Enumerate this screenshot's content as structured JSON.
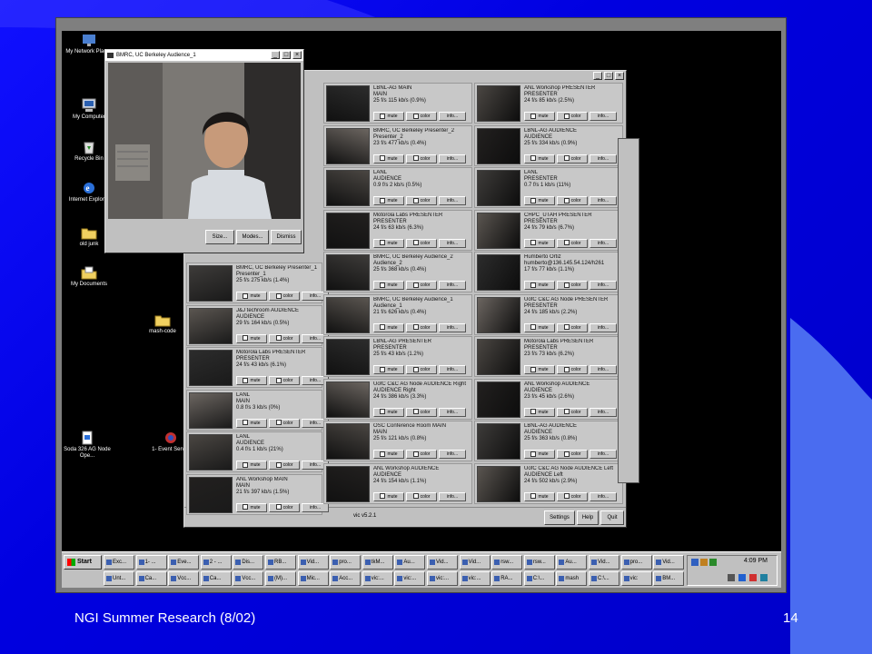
{
  "slide": {
    "footer_left": "NGI Summer Research (8/02)",
    "page_number": "14",
    "colors": {
      "background": "#0000ee",
      "frame": "#7f7f7f",
      "desktop": "#000000"
    }
  },
  "desktop_icons": [
    {
      "label": "My Network Places",
      "icon": "network-icon"
    },
    {
      "label": "My Computer",
      "icon": "computer-icon"
    },
    {
      "label": "Recycle Bin",
      "icon": "recycle-bin-icon"
    },
    {
      "label": "Internet Explorer",
      "icon": "ie-icon"
    },
    {
      "label": "old junk",
      "icon": "folder-icon"
    },
    {
      "label": "My Documents",
      "icon": "documents-icon"
    },
    {
      "label": "mash-code",
      "icon": "folder-icon"
    },
    {
      "label": "Soda 326 AG Node Ope...",
      "icon": "file-icon"
    },
    {
      "label": "1- Event Server",
      "icon": "server-icon"
    }
  ],
  "video_window": {
    "title": "BMRC, UC Berkeley Audience_1",
    "buttons": [
      "Size...",
      "Modes...",
      "Dismiss"
    ]
  },
  "vic_window": {
    "status": "vic v5.2.1",
    "buttons": [
      "Settings",
      "Help",
      "Quit"
    ],
    "labels": {
      "mute": "mute",
      "color": "color",
      "info": "info..."
    },
    "left_partial": [
      {
        "title": "BMRC, UC Berkeley Presenter_1",
        "sub": "Presenter_1",
        "stats": "25 f/s   275 kb/s   (1.4%)"
      },
      {
        "title": "J&J techroom AUDIENCE",
        "sub": "AUDIENCE",
        "stats": "29 f/s   164 kb/s   (0.5%)"
      },
      {
        "title": "Motorola Labs PRESENTER",
        "sub": "PRESENTER",
        "stats": "24 f/s   43 kb/s   (6.1%)"
      },
      {
        "title": "LANL",
        "sub": "MAIN",
        "stats": "0.8 f/s   3 kb/s   (0%)"
      },
      {
        "title": "LANL",
        "sub": "AUDIENCE",
        "stats": "0.4 f/s   1 kb/s   (21%)"
      },
      {
        "title": "ANL Workshop MAIN",
        "sub": "MAIN",
        "stats": "21 f/s   397 kb/s   (1.5%)"
      }
    ],
    "middle": [
      {
        "title": "LBNL-AG MAIN",
        "sub": "MAIN",
        "stats": "25 f/s   115 kb/s   (0.9%)"
      },
      {
        "title": "BMRC, UC Berkeley Presenter_2",
        "sub": "Presenter_2",
        "stats": "23 f/s   477 kb/s   (0.4%)"
      },
      {
        "title": "LANL",
        "sub": "AUDIENCE",
        "stats": "0.9 f/s   2 kb/s   (0.5%)"
      },
      {
        "title": "Motorola Labs PRESENTER",
        "sub": "PRESENTER",
        "stats": "24 f/s   63 kb/s   (6.3%)"
      },
      {
        "title": "BMRC, UC Berkeley Audience_2",
        "sub": "Audience_2",
        "stats": "25 f/s   368 kb/s   (0.4%)"
      },
      {
        "title": "BMRC, UC Berkeley Audience_1",
        "sub": "Audience_1",
        "stats": "21 f/s   626 kb/s   (0.4%)"
      },
      {
        "title": "LBNL-AG PRESENTER",
        "sub": "PRESENTER",
        "stats": "25 f/s   43 kb/s   (1.2%)"
      },
      {
        "title": "UofC C&C AG Node AUDIENCE Right",
        "sub": "AUDIENCE Right",
        "stats": "24 f/s   386 kb/s   (3.3%)"
      },
      {
        "title": "OSC Conference Room MAIN",
        "sub": "MAIN",
        "stats": "25 f/s   121 kb/s   (0.8%)"
      },
      {
        "title": "ANL Workshop AUDIENCE",
        "sub": "AUDIENCE",
        "stats": "24 f/s   154 kb/s   (1.1%)"
      }
    ],
    "right": [
      {
        "title": "ANL Workshop PRESENTER",
        "sub": "PRESENTER",
        "stats": "24 f/s   85 kb/s   (2.5%)"
      },
      {
        "title": "LBNL-AG AUDIENCE",
        "sub": "AUDIENCE",
        "stats": "25 f/s   334 kb/s   (0.9%)"
      },
      {
        "title": "LANL",
        "sub": "PRESENTER",
        "stats": "0.7 f/s   1 kb/s   (11%)"
      },
      {
        "title": "CHPC_UTAH PRESENTER",
        "sub": "PRESENTER",
        "stats": "24 f/s   79 kb/s   (6.7%)"
      },
      {
        "title": "Humberto Ortiz",
        "sub": "humberto@136.145.54.124/h261",
        "stats": "17 f/s   77 kb/s   (1.1%)"
      },
      {
        "title": "UofC C&C AG Node PRESENTER",
        "sub": "PRESENTER",
        "stats": "24 f/s   185 kb/s   (2.2%)"
      },
      {
        "title": "Motorola Labs PRESENTER",
        "sub": "PRESENTER",
        "stats": "23 f/s   73 kb/s   (6.2%)"
      },
      {
        "title": "ANL Workshop AUDIENCE",
        "sub": "AUDIENCE",
        "stats": "23 f/s   45 kb/s   (2.6%)"
      },
      {
        "title": "LBNL-AG AUDIENCE",
        "sub": "AUDIENCE",
        "stats": "25 f/s   363 kb/s   (0.8%)"
      },
      {
        "title": "UofC C&C AG Node AUDIENCE Left",
        "sub": "AUDIENCE Left",
        "stats": "24 f/s   502 kb/s   (2.9%)"
      }
    ]
  },
  "taskbar": {
    "start": "Start",
    "row1": [
      "Exc...",
      "1- ...",
      "Eve...",
      "2 - ...",
      "Dis...",
      "RB...",
      "Vid...",
      "pro...",
      "tkM...",
      "Au...",
      "Vid...",
      "Vid...",
      "rsw...",
      "rsw...",
      "Au...",
      "Vid...",
      "pro...",
      "Vid..."
    ],
    "row2": [
      "Unt...",
      "Ca...",
      "Vcc...",
      "Ca...",
      "Vcc...",
      "(M)...",
      "Mic...",
      "Acc...",
      "vic:...",
      "vic:...",
      "vic:...",
      "vic:...",
      "RA...",
      "C:\\...",
      "mash",
      "C:\\...",
      "vic:",
      "BM..."
    ],
    "clock": "4:09 PM"
  }
}
